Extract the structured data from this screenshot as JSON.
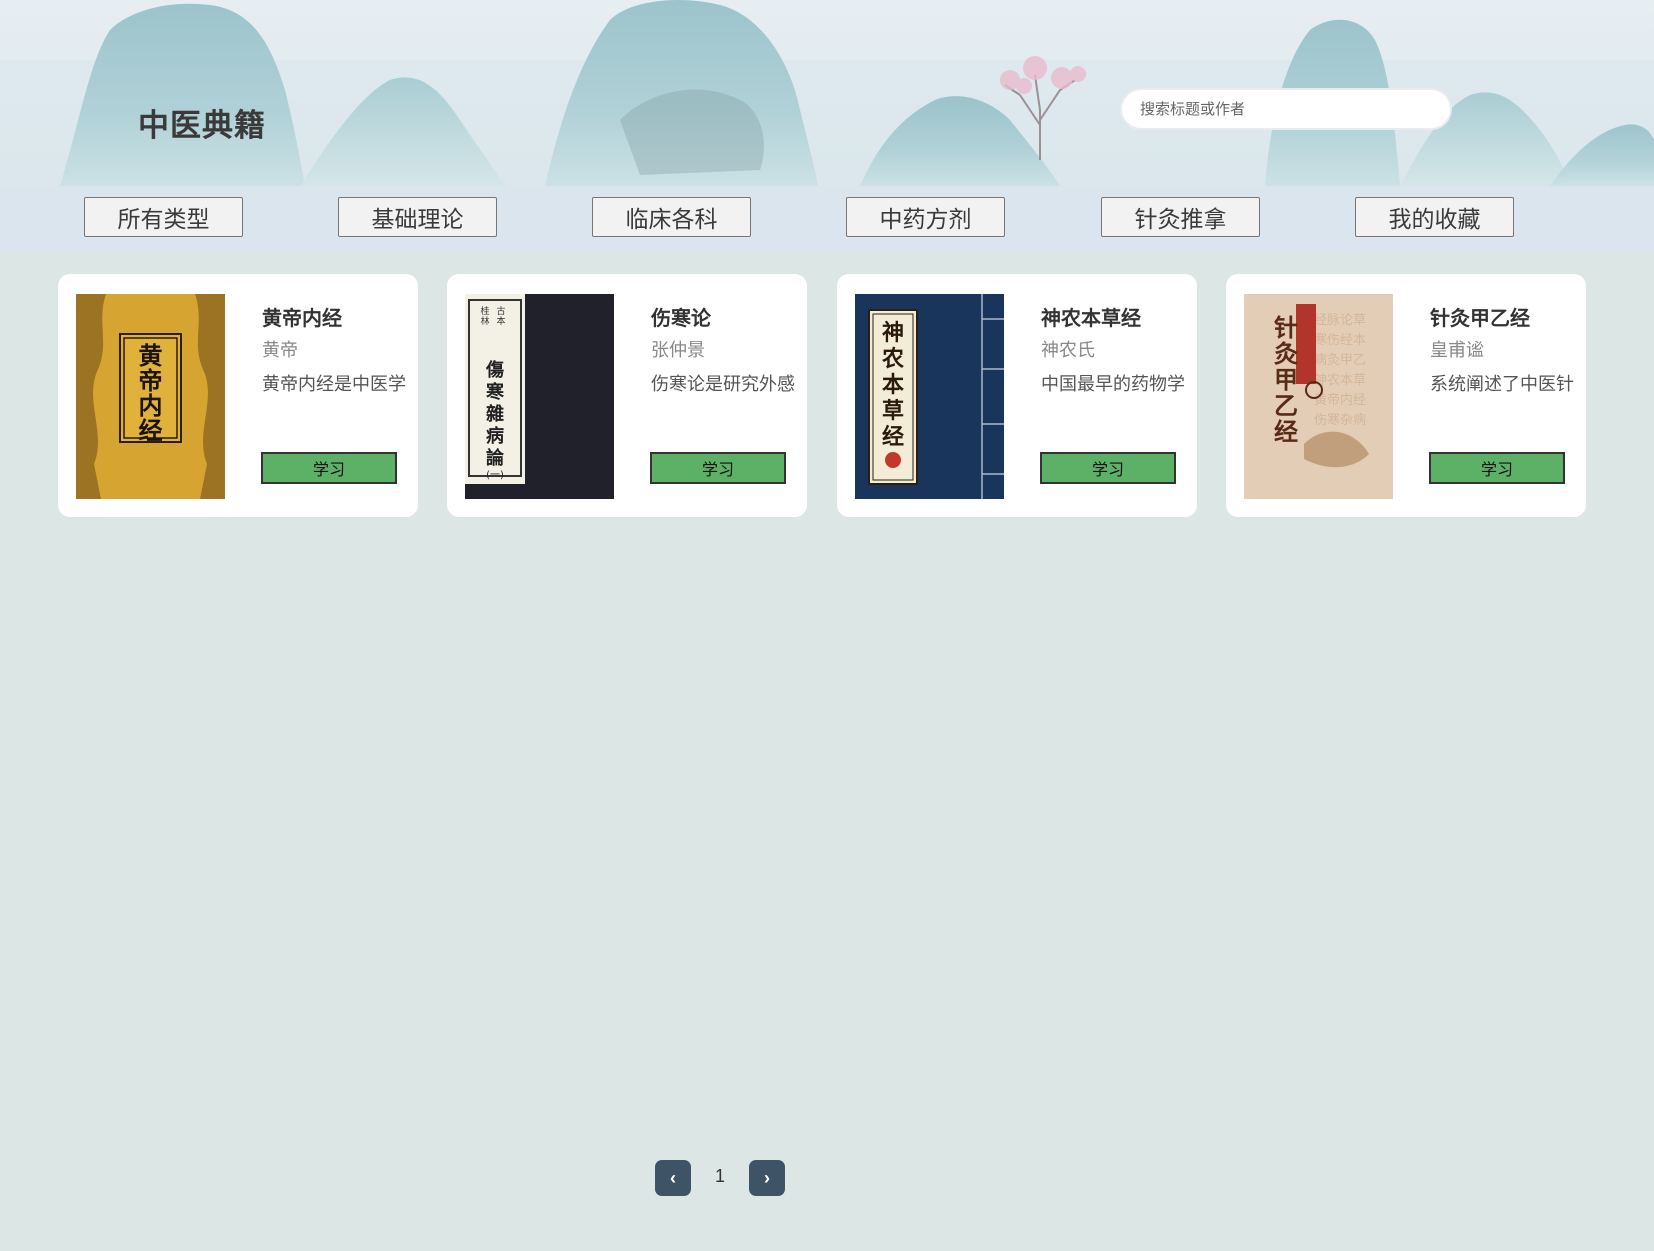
{
  "header": {
    "title": "中医典籍",
    "search_placeholder": "搜索标题或作者"
  },
  "nav": {
    "items": [
      {
        "label": "所有类型"
      },
      {
        "label": "基础理论"
      },
      {
        "label": "临床各科"
      },
      {
        "label": "中药方剂"
      },
      {
        "label": "针灸推拿"
      },
      {
        "label": "我的收藏"
      }
    ]
  },
  "books": [
    {
      "title": "黄帝内经",
      "author": "黄帝",
      "desc": "黄帝内经是中医学",
      "button": "学习",
      "cover_text": "黄帝内经"
    },
    {
      "title": "伤寒论",
      "author": "张仲景",
      "desc": "伤寒论是研究外感",
      "button": "学习",
      "cover_text": "傷寒雜病論",
      "cover_sub": "(一)",
      "cover_top": "桂林古本"
    },
    {
      "title": "神农本草经",
      "author": "神农氏",
      "desc": "中国最早的药物学",
      "button": "学习",
      "cover_text": "神农本草经"
    },
    {
      "title": "针灸甲乙经",
      "author": "皇甫谧",
      "desc": "系统阐述了中医针",
      "button": "学习",
      "cover_text": "针灸甲乙经"
    }
  ],
  "pagination": {
    "prev": "‹",
    "current": "1",
    "next": "›"
  },
  "colors": {
    "page_bg": "#dce6e4",
    "nav_bg": "#dae5ee",
    "learn_button": "#5cb166",
    "pager_button": "#3f5366"
  }
}
